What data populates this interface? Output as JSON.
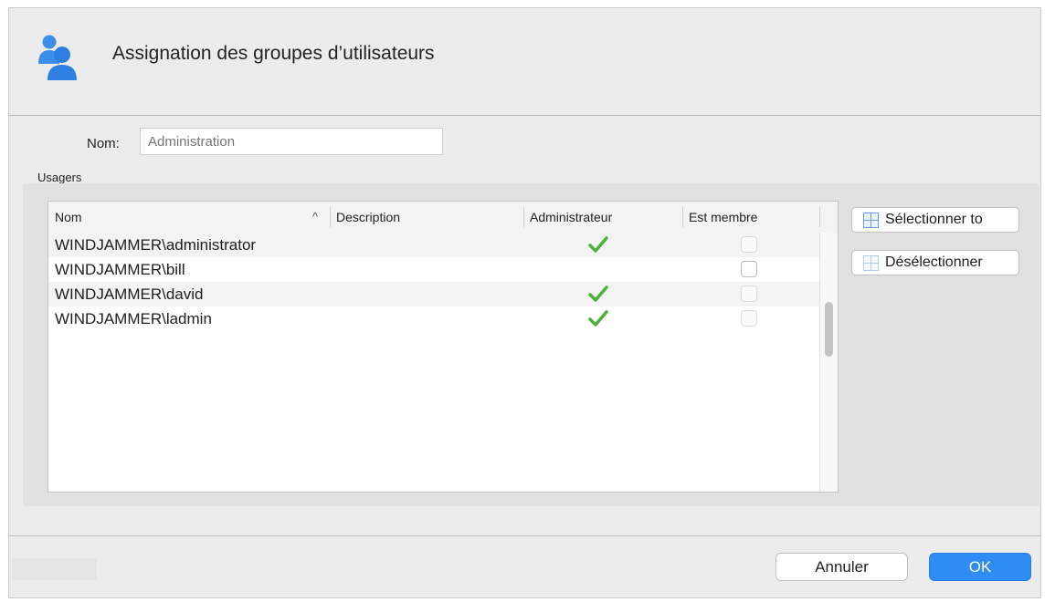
{
  "dialog": {
    "title": "Assignation des groupes d’utilisateurs",
    "icon": "users-icon"
  },
  "name_field": {
    "label": "Nom:",
    "value": "",
    "placeholder": "Administration"
  },
  "users_section": {
    "label": "Usagers",
    "columns": [
      "Nom",
      "Description",
      "Administrateur",
      "Est membre"
    ],
    "sort_icon": "chevron-up-icon",
    "rows": [
      {
        "name": "WINDJAMMER\\administrator",
        "description": "",
        "is_admin": true,
        "is_member": false,
        "member_enabled": false
      },
      {
        "name": "WINDJAMMER\\bill",
        "description": "",
        "is_admin": false,
        "is_member": false,
        "member_enabled": true
      },
      {
        "name": "WINDJAMMER\\david",
        "description": "",
        "is_admin": true,
        "is_member": false,
        "member_enabled": false
      },
      {
        "name": "WINDJAMMER\\ladmin",
        "description": "",
        "is_admin": true,
        "is_member": false,
        "member_enabled": false
      }
    ]
  },
  "side_buttons": {
    "select_all": "Sélectionner to",
    "deselect": "Désélectionner"
  },
  "footer": {
    "cancel": "Annuler",
    "ok": "OK"
  },
  "colors": {
    "accent": "#2f8cf5",
    "check": "#4cb33a"
  }
}
